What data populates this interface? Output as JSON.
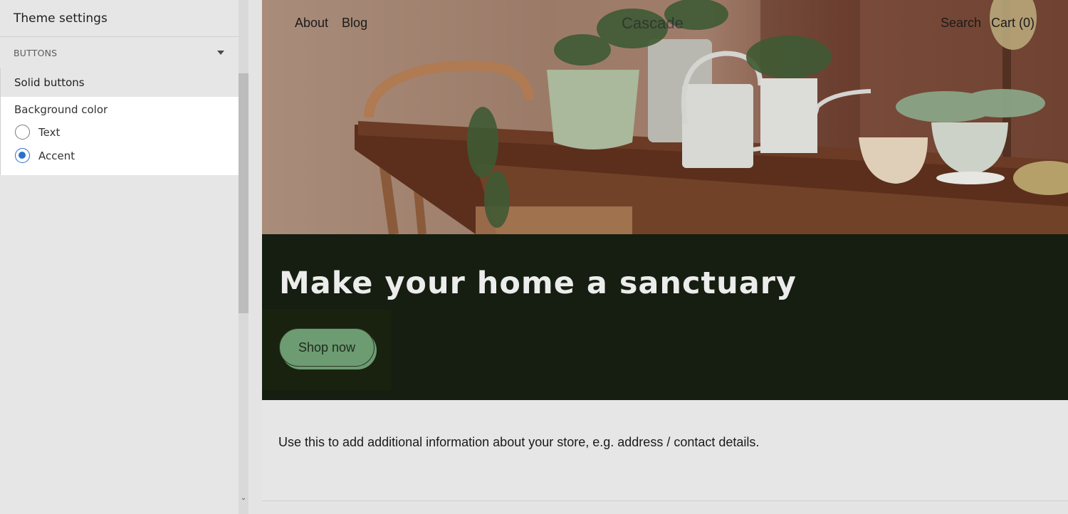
{
  "sidebar": {
    "title": "Theme settings",
    "section": {
      "label": "BUTTONS",
      "icon": "caret-down-icon"
    },
    "subsection": "Solid buttons",
    "field": {
      "label": "Background color",
      "options": [
        {
          "label": "Text",
          "selected": false
        },
        {
          "label": "Accent",
          "selected": true
        }
      ]
    }
  },
  "preview": {
    "nav": {
      "left": [
        "About",
        "Blog"
      ],
      "logo": "Cascade",
      "right": [
        "Search",
        "Cart (0)"
      ]
    },
    "hero_image": "living room table with potted plants and watering can",
    "banner": {
      "headline": "Make your home a sanctuary",
      "button": "Shop now"
    },
    "footer_text": "Use this to add additional information about your store, e.g. address / contact details."
  },
  "colors": {
    "accent": "#6d9b72",
    "banner_bg": "#151e10",
    "radio_selected": "#2c6ecb"
  }
}
